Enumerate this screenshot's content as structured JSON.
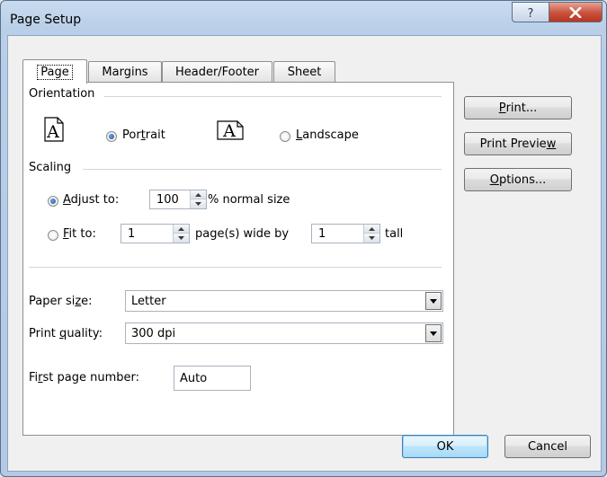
{
  "window": {
    "title": "Page Setup"
  },
  "titlebar": {
    "help_glyph": "?"
  },
  "tabs": [
    {
      "label": "Page",
      "active": true
    },
    {
      "label": "Margins",
      "active": false
    },
    {
      "label": "Header/Footer",
      "active": false
    },
    {
      "label": "Sheet",
      "active": false
    }
  ],
  "orientation": {
    "title": "Orientation",
    "icon_letter": "A",
    "portrait": {
      "label_pre": "Por",
      "accel": "t",
      "label_post": "rait",
      "selected": true
    },
    "landscape": {
      "label_pre": "",
      "accel": "L",
      "label_post": "andscape",
      "selected": false
    }
  },
  "scaling": {
    "title": "Scaling",
    "adjust": {
      "label_pre": "",
      "accel": "A",
      "label_post": "djust to:",
      "selected": true,
      "value": "100",
      "suffix": "% normal size"
    },
    "fit": {
      "label_pre": "",
      "accel": "F",
      "label_post": "it to:",
      "selected": false,
      "wide_value": "1",
      "wide_suffix": "page(s) wide by",
      "tall_value": "1",
      "tall_suffix": "tall"
    }
  },
  "paper_size": {
    "label_pre": "Paper si",
    "accel": "z",
    "label_post": "e:",
    "value": "Letter"
  },
  "print_quality": {
    "label_pre": "Print ",
    "accel": "q",
    "label_post": "uality:",
    "value": "300 dpi"
  },
  "first_page": {
    "label_pre": "Fi",
    "accel": "r",
    "label_post": "st page number:",
    "value": "Auto"
  },
  "side_buttons": {
    "print": {
      "pre": "",
      "accel": "P",
      "post": "rint..."
    },
    "preview": {
      "pre": "Print Previe",
      "accel": "w",
      "post": ""
    },
    "options": {
      "pre": "",
      "accel": "O",
      "post": "ptions..."
    }
  },
  "footer": {
    "ok": "OK",
    "cancel": "Cancel"
  },
  "icons": {
    "help": "help-icon",
    "close": "close-icon",
    "portrait": "portrait-page-icon",
    "landscape": "landscape-page-icon",
    "spin": "spin-arrows-icon",
    "dropdown": "chevron-down-icon"
  },
  "colors": {
    "titlebar": "#b9cfe8",
    "close": "#c9503a",
    "default_button_border": "#3c7fb1"
  }
}
